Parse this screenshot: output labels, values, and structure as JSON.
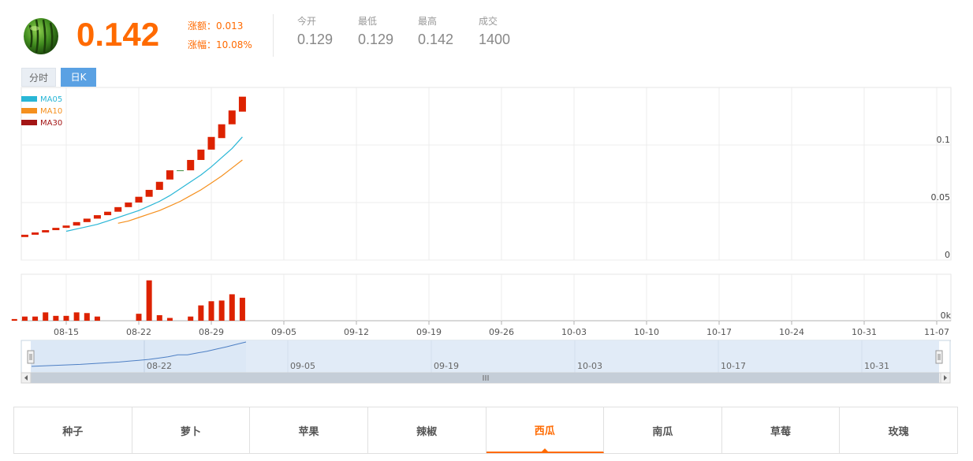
{
  "header": {
    "logo_icon": "watermelon-icon",
    "price": "0.142",
    "change_label": "涨额：",
    "change_value": "0.013",
    "pct_label": "涨幅：",
    "pct_value": "10.08%",
    "stats": [
      {
        "label": "今开",
        "value": "0.129"
      },
      {
        "label": "最低",
        "value": "0.129"
      },
      {
        "label": "最高",
        "value": "0.142"
      },
      {
        "label": "成交",
        "value": "1400"
      }
    ]
  },
  "tabs": [
    {
      "label": "分时",
      "active": false
    },
    {
      "label": "日K",
      "active": true
    }
  ],
  "colors": {
    "up": "#dd2200",
    "ma05": "#29b6d6",
    "ma10": "#f5901e",
    "ma30": "#a31515",
    "accent": "#ff6a00",
    "tab_active": "#5aa1e3"
  },
  "chart_data": {
    "type": "candlestick",
    "legend": [
      {
        "name": "MA05",
        "color": "#29b6d6"
      },
      {
        "name": "MA10",
        "color": "#f5901e"
      },
      {
        "name": "MA30",
        "color": "#a31515"
      }
    ],
    "x_tick_labels": [
      "08-15",
      "08-22",
      "08-29",
      "09-05",
      "09-12",
      "09-19",
      "09-26",
      "10-03",
      "10-10",
      "10-17",
      "10-24",
      "10-31",
      "11-07"
    ],
    "y_tick_labels": [
      "0.1",
      "0.05",
      "0"
    ],
    "ylim": [
      0,
      0.15
    ],
    "volume_tick_label": "0k",
    "candles": [
      {
        "date": "08-11",
        "open": 0.02,
        "close": 0.022
      },
      {
        "date": "08-12",
        "open": 0.022,
        "close": 0.024
      },
      {
        "date": "08-13",
        "open": 0.024,
        "close": 0.026
      },
      {
        "date": "08-14",
        "open": 0.026,
        "close": 0.028
      },
      {
        "date": "08-15",
        "open": 0.028,
        "close": 0.03
      },
      {
        "date": "08-16",
        "open": 0.03,
        "close": 0.033
      },
      {
        "date": "08-17",
        "open": 0.033,
        "close": 0.036
      },
      {
        "date": "08-18",
        "open": 0.036,
        "close": 0.039
      },
      {
        "date": "08-19",
        "open": 0.039,
        "close": 0.042
      },
      {
        "date": "08-20",
        "open": 0.042,
        "close": 0.046
      },
      {
        "date": "08-21",
        "open": 0.046,
        "close": 0.05
      },
      {
        "date": "08-22",
        "open": 0.05,
        "close": 0.055
      },
      {
        "date": "08-23",
        "open": 0.055,
        "close": 0.061
      },
      {
        "date": "08-24",
        "open": 0.061,
        "close": 0.068
      },
      {
        "date": "08-25",
        "open": 0.07,
        "close": 0.078
      },
      {
        "date": "08-26",
        "open": 0.078,
        "close": 0.078
      },
      {
        "date": "08-27",
        "open": 0.078,
        "close": 0.087
      },
      {
        "date": "08-28",
        "open": 0.087,
        "close": 0.096
      },
      {
        "date": "08-29",
        "open": 0.096,
        "close": 0.107
      },
      {
        "date": "08-30",
        "open": 0.106,
        "close": 0.118
      },
      {
        "date": "08-31",
        "open": 0.118,
        "close": 0.13
      },
      {
        "date": "09-01",
        "open": 0.129,
        "close": 0.142
      }
    ],
    "ma05": [
      null,
      null,
      null,
      null,
      0.025,
      0.027,
      0.029,
      0.031,
      0.034,
      0.037,
      0.04,
      0.043,
      0.047,
      0.051,
      0.056,
      0.062,
      0.068,
      0.074,
      0.081,
      0.089,
      0.097,
      0.107
    ],
    "ma10": [
      null,
      null,
      null,
      null,
      null,
      null,
      null,
      null,
      null,
      0.032,
      0.034,
      0.037,
      0.04,
      0.043,
      0.047,
      0.051,
      0.056,
      0.061,
      0.067,
      0.073,
      0.08,
      0.087
    ],
    "volume": [
      12,
      30,
      30,
      60,
      35,
      35,
      60,
      55,
      30,
      0,
      0,
      0,
      50,
      290,
      40,
      20,
      0,
      30,
      110,
      140,
      145,
      190,
      165
    ],
    "volume_max": 300,
    "navigator_labels": [
      "08-22",
      "09-05",
      "09-19",
      "10-03",
      "10-17",
      "10-31"
    ],
    "navigator_series": [
      0.02,
      0.022,
      0.024,
      0.026,
      0.028,
      0.03,
      0.033,
      0.036,
      0.039,
      0.042,
      0.046,
      0.05,
      0.055,
      0.061,
      0.068,
      0.078,
      0.078,
      0.087,
      0.096,
      0.107,
      0.118,
      0.13,
      0.142
    ]
  },
  "fruit_tabs": [
    {
      "label": "种子",
      "active": false
    },
    {
      "label": "萝卜",
      "active": false
    },
    {
      "label": "苹果",
      "active": false
    },
    {
      "label": "辣椒",
      "active": false
    },
    {
      "label": "西瓜",
      "active": true
    },
    {
      "label": "南瓜",
      "active": false
    },
    {
      "label": "草莓",
      "active": false
    },
    {
      "label": "玫瑰",
      "active": false
    }
  ]
}
